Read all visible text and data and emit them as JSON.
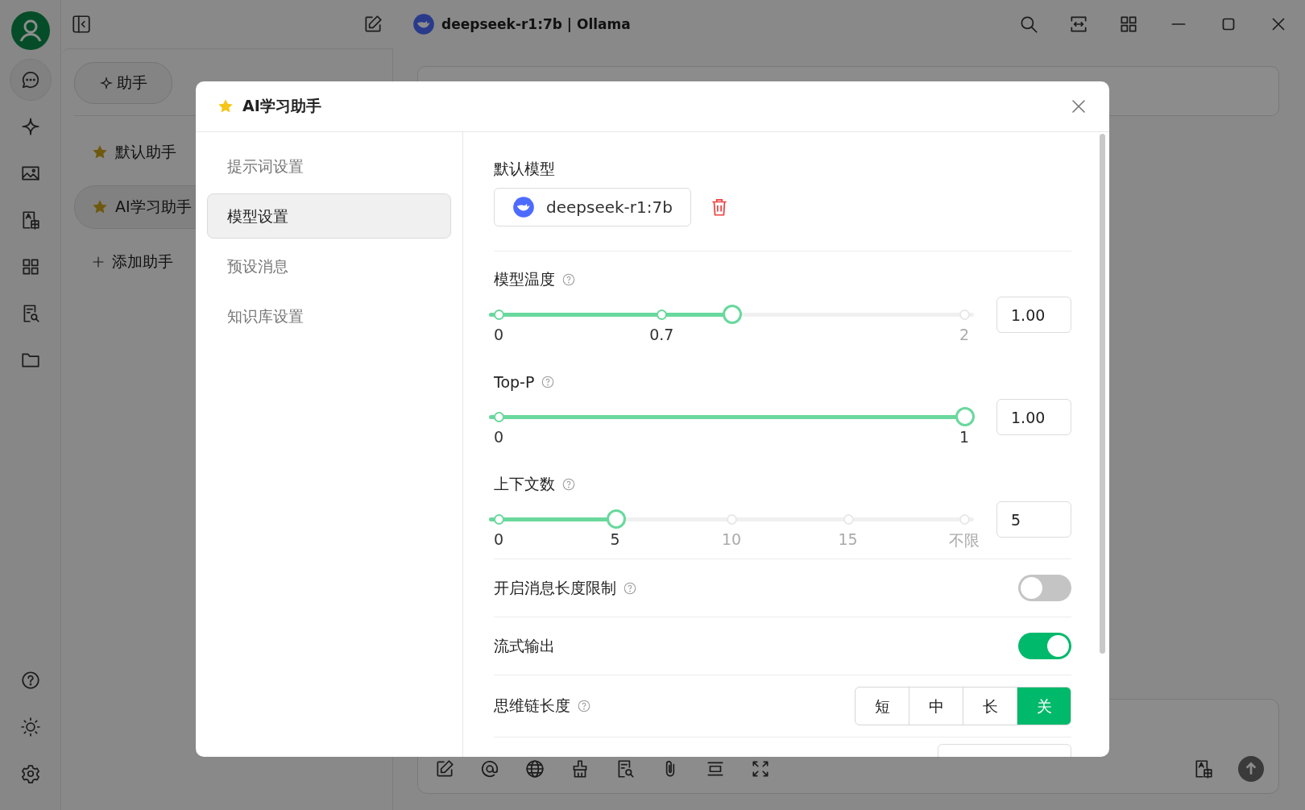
{
  "window": {
    "title": "deepseek-r1:7b | Ollama"
  },
  "rail": {
    "items": [
      {
        "kind": "chat",
        "selected": true
      },
      {
        "kind": "sparkle",
        "selected": false
      },
      {
        "kind": "image",
        "selected": false
      },
      {
        "kind": "translate",
        "selected": false
      },
      {
        "kind": "apps",
        "selected": false
      },
      {
        "kind": "docsearch",
        "selected": false
      },
      {
        "kind": "folder",
        "selected": false
      }
    ],
    "bottom": [
      {
        "kind": "help"
      },
      {
        "kind": "theme"
      },
      {
        "kind": "settings"
      }
    ]
  },
  "sidebar": {
    "tabs": [
      {
        "label": "助手",
        "selected": true
      }
    ],
    "assistants": [
      {
        "name": "默认助手",
        "selected": false
      },
      {
        "name": "AI学习助手",
        "selected": true
      }
    ],
    "add_label": "添加助手"
  },
  "composer": {
    "tools": [
      {
        "kind": "edit"
      },
      {
        "kind": "at"
      },
      {
        "kind": "globe"
      },
      {
        "kind": "broom"
      },
      {
        "kind": "docsearch"
      },
      {
        "kind": "clip"
      },
      {
        "kind": "rows"
      },
      {
        "kind": "expand"
      }
    ]
  },
  "dialog": {
    "title": "AI学习助手",
    "nav": [
      {
        "label": "提示词设置",
        "selected": false
      },
      {
        "label": "模型设置",
        "selected": true
      },
      {
        "label": "预设消息",
        "selected": false
      },
      {
        "label": "知识库设置",
        "selected": false
      }
    ],
    "default_model": {
      "label": "默认模型",
      "model": "deepseek-r1:7b"
    },
    "sliders": [
      {
        "label": "模型温度",
        "help": true,
        "value": "1.00",
        "level": 0.5,
        "marks": [
          {
            "label": "0",
            "level": 0
          },
          {
            "label": "0.7",
            "level": 0.35
          },
          {
            "label": "2",
            "level": 1
          }
        ]
      },
      {
        "label": "Top-P",
        "help": true,
        "value": "1.00",
        "level": 1,
        "marks": [
          {
            "label": "0",
            "level": 0
          },
          {
            "label": "1",
            "level": 1
          }
        ]
      },
      {
        "label": "上下文数",
        "help": true,
        "value": "5",
        "level": 0.25,
        "marks": [
          {
            "label": "0",
            "level": 0
          },
          {
            "label": "5",
            "level": 0.25
          },
          {
            "label": "10",
            "level": 0.5
          },
          {
            "label": "15",
            "level": 0.75
          },
          {
            "label": "不限",
            "level": 1
          }
        ]
      }
    ],
    "toggles": [
      {
        "label": "开启消息长度限制",
        "help": true,
        "on": false
      },
      {
        "label": "流式输出",
        "help": false,
        "on": true
      }
    ],
    "segmented": {
      "label": "思维链长度",
      "help": true,
      "options": [
        {
          "label": "短",
          "selected": false
        },
        {
          "label": "中",
          "selected": false
        },
        {
          "label": "长",
          "selected": false
        },
        {
          "label": "关",
          "selected": true
        }
      ]
    }
  }
}
